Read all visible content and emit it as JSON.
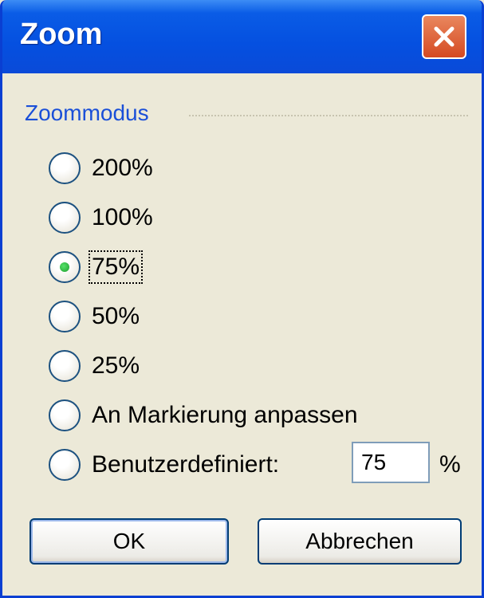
{
  "window": {
    "title": "Zoom",
    "close_icon": "close-icon"
  },
  "group": {
    "label": "Zoommodus"
  },
  "options": [
    {
      "label": "200%",
      "selected": false
    },
    {
      "label": "100%",
      "selected": false
    },
    {
      "label": "75%",
      "selected": true
    },
    {
      "label": "50%",
      "selected": false
    },
    {
      "label": "25%",
      "selected": false
    },
    {
      "label": "An Markierung anpassen",
      "selected": false
    },
    {
      "label": "Benutzerdefiniert:",
      "selected": false
    }
  ],
  "custom": {
    "value": "75",
    "unit": "%"
  },
  "buttons": {
    "ok": "OK",
    "cancel": "Abbrechen"
  },
  "colors": {
    "titlebar": "#0550E0",
    "group_label": "#1A4FD8",
    "close_button": "#D54A22"
  }
}
